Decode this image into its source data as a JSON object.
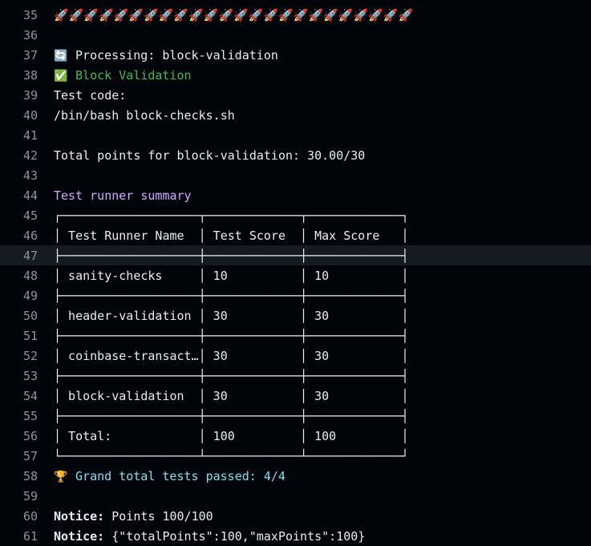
{
  "lines": [
    {
      "n": "35",
      "text": "🚀🚀🚀🚀🚀🚀🚀🚀🚀🚀🚀🚀🚀🚀🚀🚀🚀🚀🚀🚀🚀🚀🚀🚀"
    },
    {
      "n": "36",
      "text": ""
    },
    {
      "n": "37",
      "icon": "🔄",
      "text": " Processing: block-validation"
    },
    {
      "n": "38",
      "icon": "✅",
      "text": " Block Validation",
      "color": "green"
    },
    {
      "n": "39",
      "text": "Test code:"
    },
    {
      "n": "40",
      "text": "/bin/bash block-checks.sh"
    },
    {
      "n": "41",
      "text": ""
    },
    {
      "n": "42",
      "text": "Total points for block-validation: 30.00/30"
    },
    {
      "n": "43",
      "text": ""
    },
    {
      "n": "44",
      "text": "Test runner summary",
      "color": "purple"
    },
    {
      "n": "45",
      "text": "┌───────────────────┬─────────────┬─────────────┐"
    },
    {
      "n": "46",
      "text": "│ Test Runner Name  │ Test Score  │ Max Score   │"
    },
    {
      "n": "47",
      "text": "├───────────────────┼─────────────┼─────────────┤",
      "highlight": true
    },
    {
      "n": "48",
      "text": "│ sanity-checks     │ 10          │ 10          │"
    },
    {
      "n": "49",
      "text": "├───────────────────┼─────────────┼─────────────┤"
    },
    {
      "n": "50",
      "text": "│ header-validation │ 30          │ 30          │"
    },
    {
      "n": "51",
      "text": "├───────────────────┼─────────────┼─────────────┤"
    },
    {
      "n": "52",
      "text": "│ coinbase-transact…│ 30          │ 30          │"
    },
    {
      "n": "53",
      "text": "├───────────────────┼─────────────┼─────────────┤"
    },
    {
      "n": "54",
      "text": "│ block-validation  │ 30          │ 30          │"
    },
    {
      "n": "55",
      "text": "├───────────────────┼─────────────┼─────────────┤"
    },
    {
      "n": "56",
      "text": "│ Total:            │ 100         │ 100         │"
    },
    {
      "n": "57",
      "text": "└───────────────────┴─────────────┴─────────────┘"
    },
    {
      "n": "58",
      "icon": "🏆",
      "text": " Grand total tests passed: 4/4",
      "color": "cyan"
    },
    {
      "n": "59",
      "text": ""
    },
    {
      "n": "60",
      "bold": "Notice:",
      "text": " Points 100/100"
    },
    {
      "n": "61",
      "bold": "Notice:",
      "text": " {\"totalPoints\":100,\"maxPoints\":100}"
    }
  ]
}
